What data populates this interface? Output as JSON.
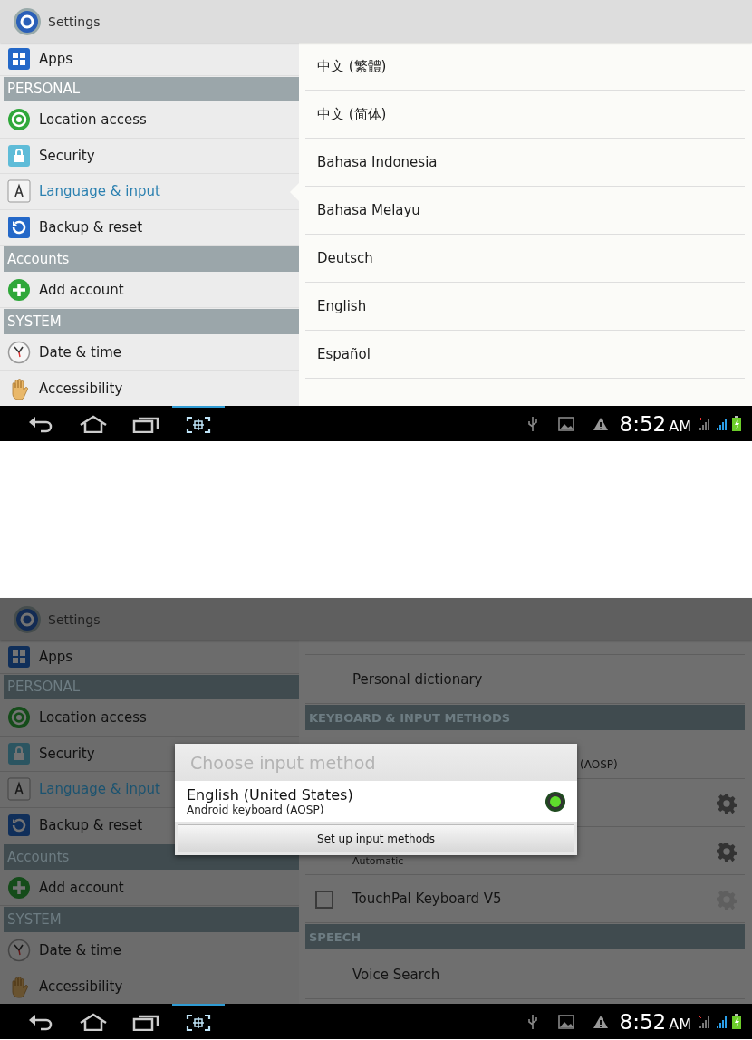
{
  "screens": [
    {
      "dimmed": false,
      "action_bar": {
        "title": "Settings"
      },
      "sidebar": [
        {
          "kind": "item",
          "label": "Apps",
          "selected": false
        },
        {
          "kind": "header",
          "label": "PERSONAL"
        },
        {
          "kind": "item",
          "label": "Location access",
          "selected": false
        },
        {
          "kind": "item",
          "label": "Security",
          "selected": false
        },
        {
          "kind": "item",
          "label": "Language & input",
          "selected": true
        },
        {
          "kind": "item",
          "label": "Backup & reset",
          "selected": false
        },
        {
          "kind": "header",
          "label": "Accounts"
        },
        {
          "kind": "item",
          "label": "Add account",
          "selected": false
        },
        {
          "kind": "header",
          "label": "SYSTEM"
        },
        {
          "kind": "item",
          "label": "Date & time",
          "selected": false
        },
        {
          "kind": "item",
          "label": "Accessibility",
          "selected": false
        }
      ],
      "pane": {
        "rows": [
          {
            "kind": "language",
            "title": "中文 (繁體)"
          },
          {
            "kind": "language",
            "title": "中文 (简体)"
          },
          {
            "kind": "language",
            "title": "Bahasa Indonesia"
          },
          {
            "kind": "language",
            "title": "Bahasa Melayu"
          },
          {
            "kind": "language",
            "title": "Deutsch"
          },
          {
            "kind": "language",
            "title": "English"
          },
          {
            "kind": "language",
            "title": "Español"
          }
        ]
      },
      "nav_bar": {
        "time": "8:52",
        "meridiem": "AM"
      }
    },
    {
      "dimmed": true,
      "action_bar": {
        "title": "Settings"
      },
      "sidebar": [
        {
          "kind": "item",
          "label": "Apps",
          "selected": false
        },
        {
          "kind": "header",
          "label": "PERSONAL"
        },
        {
          "kind": "item",
          "label": "Location access",
          "selected": false
        },
        {
          "kind": "item",
          "label": "Security",
          "selected": false
        },
        {
          "kind": "item",
          "label": "Language & input",
          "selected": true
        },
        {
          "kind": "item",
          "label": "Backup & reset",
          "selected": false
        },
        {
          "kind": "header",
          "label": "Accounts"
        },
        {
          "kind": "item",
          "label": "Add account",
          "selected": false
        },
        {
          "kind": "header",
          "label": "SYSTEM"
        },
        {
          "kind": "item",
          "label": "Date & time",
          "selected": false
        },
        {
          "kind": "item",
          "label": "Accessibility",
          "selected": false
        }
      ],
      "pane": {
        "rows": [
          {
            "kind": "top"
          },
          {
            "kind": "item",
            "title": "Personal dictionary"
          },
          {
            "kind": "header",
            "title": "KEYBOARD & INPUT METHODS"
          },
          {
            "kind": "default",
            "summary": "(AOSP)"
          },
          {
            "kind": "method",
            "gear_enabled": true
          },
          {
            "kind": "method",
            "summary": "Automatic",
            "gear_enabled": true
          },
          {
            "kind": "method",
            "title": "TouchPal Keyboard V5",
            "checked": false,
            "gear_enabled": false
          },
          {
            "kind": "header",
            "title": "SPEECH"
          },
          {
            "kind": "item",
            "title": "Voice Search"
          }
        ]
      },
      "dialog": {
        "title": "Choose input method",
        "options": [
          {
            "label": "English (United States)",
            "summary": "Android keyboard (AOSP)",
            "selected": true
          }
        ],
        "button": "Set up input methods"
      },
      "nav_bar": {
        "time": "8:52",
        "meridiem": "AM"
      }
    }
  ]
}
